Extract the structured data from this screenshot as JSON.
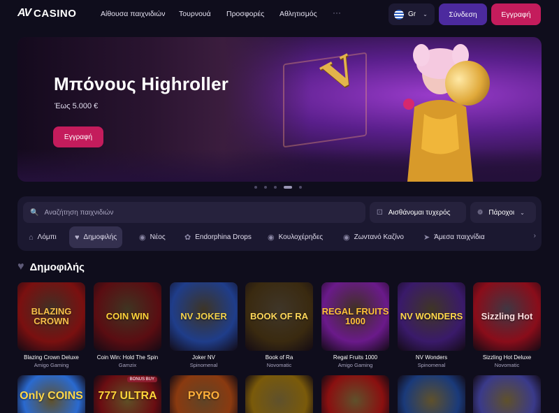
{
  "header": {
    "logo_mark": "AV",
    "logo_text": "CASINO",
    "nav": [
      "Αίθουσα παιχνιδιών",
      "Τουρνουά",
      "Προσφορές",
      "Αθλητισμός",
      "···"
    ],
    "language": "Gr",
    "login_label": "Σύνδεση",
    "register_label": "Εγγραφή"
  },
  "banner": {
    "title": "Μπόνους Highroller",
    "subtitle": "Έως 5.000 €",
    "button_label": "Εγγραφή",
    "slide_count": 5,
    "active_slide": 4
  },
  "search": {
    "placeholder": "Αναζήτηση παιχνιδιών",
    "feeling_lucky": "Αισθάνομαι τυχερός",
    "providers": "Πάροχοι"
  },
  "categories": [
    {
      "label": "Λόμπι",
      "icon": "home-icon"
    },
    {
      "label": "Δημοφιλής",
      "icon": "heart-icon",
      "active": true
    },
    {
      "label": "Νέος",
      "icon": "new-icon"
    },
    {
      "label": "Endorphina Drops",
      "icon": "drop-icon"
    },
    {
      "label": "Κουλοχέρηδες",
      "icon": "slot-icon"
    },
    {
      "label": "Ζωντανό Καζίνο",
      "icon": "chip-icon"
    },
    {
      "label": "Άμεσα παιχνίδια",
      "icon": "rocket-icon"
    }
  ],
  "section": {
    "title": "Δημοφιλής"
  },
  "games": [
    {
      "name": "Blazing Crown Deluxe",
      "provider": "Amigo Gaming",
      "thumb_text": "BLAZING CROWN",
      "bg": "#7a1010",
      "fg": "#f7c04a"
    },
    {
      "name": "Coin Win: Hold The Spin",
      "provider": "Gamzix",
      "thumb_text": "COIN WIN",
      "bg": "#5a0d12",
      "fg": "#ffd43a"
    },
    {
      "name": "Joker NV",
      "provider": "Spinomenal",
      "thumb_text": "NV JOKER",
      "bg": "#1f3d8a",
      "fg": "#f4d24a"
    },
    {
      "name": "Book of Ra",
      "provider": "Novomatic",
      "thumb_text": "BOOK OF RA",
      "bg": "#3a2a10",
      "fg": "#ffd85a"
    },
    {
      "name": "Regal Fruits 1000",
      "provider": "Amigo Gaming",
      "thumb_text": "REGAL FRUITS 1000",
      "bg": "#6a1a8a",
      "fg": "#ffc23a"
    },
    {
      "name": "NV Wonders",
      "provider": "Spinomenal",
      "thumb_text": "NV WONDERS",
      "bg": "#3a1a6a",
      "fg": "#ffd84a"
    },
    {
      "name": "Sizzling Hot Deluxe",
      "provider": "Novomatic",
      "thumb_text": "Sizzling Hot",
      "bg": "#8a0d1a",
      "fg": "#ffe0e0"
    }
  ],
  "games_row2": [
    {
      "thumb_text": "Only COINS",
      "bg": "#2a6ad0",
      "fg": "#ffd84a"
    },
    {
      "thumb_text": "777 ULTRA",
      "bg": "#6a0d12",
      "fg": "#ffd43a",
      "badge": "BONUS BUY"
    },
    {
      "thumb_text": "PYRO",
      "bg": "#8a3a10",
      "fg": "#ffb03a"
    },
    {
      "thumb_text": "",
      "bg": "#7a5a0a",
      "fg": "#ffd84a"
    },
    {
      "thumb_text": "",
      "bg": "#8a1010",
      "fg": "#ffd84a"
    },
    {
      "thumb_text": "",
      "bg": "#1a3a7a",
      "fg": "#ffd84a"
    },
    {
      "thumb_text": "",
      "bg": "#3a3a8a",
      "fg": "#ffd84a"
    }
  ]
}
